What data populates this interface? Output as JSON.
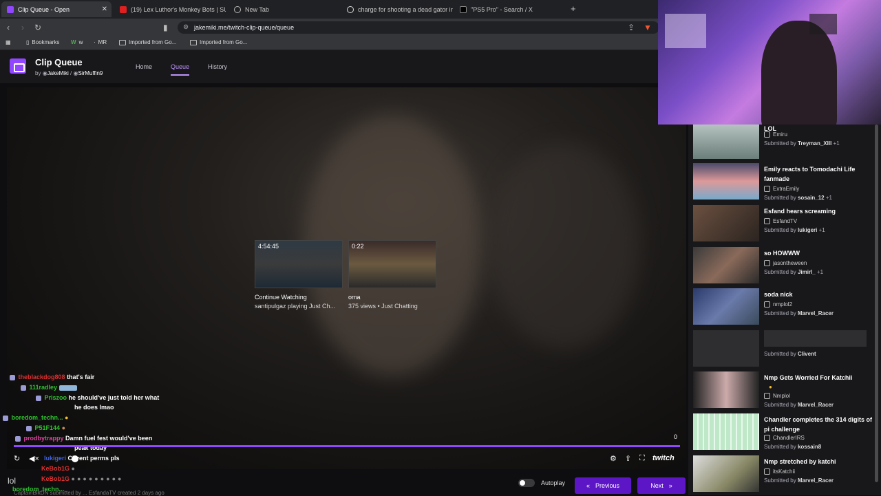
{
  "browser": {
    "tabs": [
      {
        "title": "Clip Queue - Open",
        "active": true,
        "close": "✕"
      },
      {
        "title": "(19) Lex Luthor's Monkey Bots | SUP",
        "active": false
      },
      {
        "title": "New Tab",
        "active": false
      },
      {
        "title": "charge for shooting a dead gator in l",
        "active": false
      },
      {
        "title": "\"PS5 Pro\" - Search / X",
        "active": false
      }
    ],
    "new_tab": "+",
    "url": "jakemiki.me/twitch-clip-queue/queue",
    "bookmarks": [
      "Bookmarks",
      "w",
      "MR",
      "Imported from Go...",
      "Imported from Go..."
    ]
  },
  "app": {
    "title": "Clip Queue",
    "by": "by",
    "author1": "JakeMiki",
    "sep": "/",
    "author2": "SirMuffin9",
    "nav": [
      "Home",
      "Queue",
      "History"
    ],
    "active_nav": "Queue",
    "brand_color": "#9147ff"
  },
  "player": {
    "progress_value": "0",
    "twitch_label": "twitch",
    "cards": [
      {
        "duration": "4:54:45",
        "title": "Continue Watching",
        "subtitle": "santipulgaz playing Just Ch..."
      },
      {
        "duration": "0:22",
        "title": "oma",
        "subtitle": "375 views • Just Chatting"
      }
    ]
  },
  "chat": [
    {
      "user": "theblackdog808",
      "color": "#e03030",
      "msg": "that's fair"
    },
    {
      "user": "111radley",
      "color": "#30c030",
      "msg": ""
    },
    {
      "user": "Priszoo",
      "color": "#30c030",
      "msg": "he should've just told her what"
    },
    {
      "user": "",
      "color": "#fff",
      "msg": "he does lmao"
    },
    {
      "user": "boredom_techn...",
      "color": "#30c030",
      "msg": ""
    },
    {
      "user": "P51F144",
      "color": "#30c030",
      "msg": ""
    },
    {
      "user": "prodbytrappy",
      "color": "#e040a0",
      "msg": "Damn fuel fest would've been"
    },
    {
      "user": "",
      "color": "#fff",
      "msg": "peak today"
    },
    {
      "user": "lukigeri",
      "color": "#4060e0",
      "msg": "Clivent perms pls"
    },
    {
      "user": "KeBob1G",
      "color": "#e03030",
      "msg": ""
    },
    {
      "user": "KeBob1G",
      "color": "#e03030",
      "msg": ""
    },
    {
      "user": "boredom_techn...",
      "color": "#30c030",
      "msg": ""
    }
  ],
  "below": {
    "lol": "lol",
    "info": "CaptainBlkDN submitted by ... EsfandaTV   created 2 days ago",
    "autoplay": "Autoplay",
    "previous": "Previous",
    "next": "Next"
  },
  "queue": [
    {
      "title": "LOL",
      "channel": "Emiru",
      "submitted_by": "Treyman_XIII",
      "extra": "+1"
    },
    {
      "title": "Emily reacts to Tomodachi Life fanmade",
      "channel": "ExtraEmily",
      "submitted_by": "sosain_12",
      "extra": "+1"
    },
    {
      "title": "Esfand hears screaming",
      "channel": "EsfandTV",
      "submitted_by": "lukigeri",
      "extra": "+1"
    },
    {
      "title": "so HOWWW",
      "channel": "jasontheween",
      "submitted_by": "Jimirl_",
      "extra": "+1"
    },
    {
      "title": "soda nick",
      "channel": "nmplol2",
      "submitted_by": "Marvel_Racer",
      "extra": ""
    },
    {
      "title": "",
      "channel": "",
      "submitted_by": "Clivent",
      "extra": ""
    },
    {
      "title": "Nmp Gets Worried For Katchii",
      "channel": "Nmplol",
      "submitted_by": "Marvel_Racer",
      "extra": ""
    },
    {
      "title": "Chandler completes the 314 digits of pi challenge",
      "channel": "ChandlerIRS",
      "submitted_by": "kossain8",
      "extra": ""
    },
    {
      "title": "Nmp stretched by katchi",
      "channel": "itsKatchii",
      "submitted_by": "Marvel_Racer",
      "extra": ""
    }
  ],
  "submitted_label": "Submitted by"
}
